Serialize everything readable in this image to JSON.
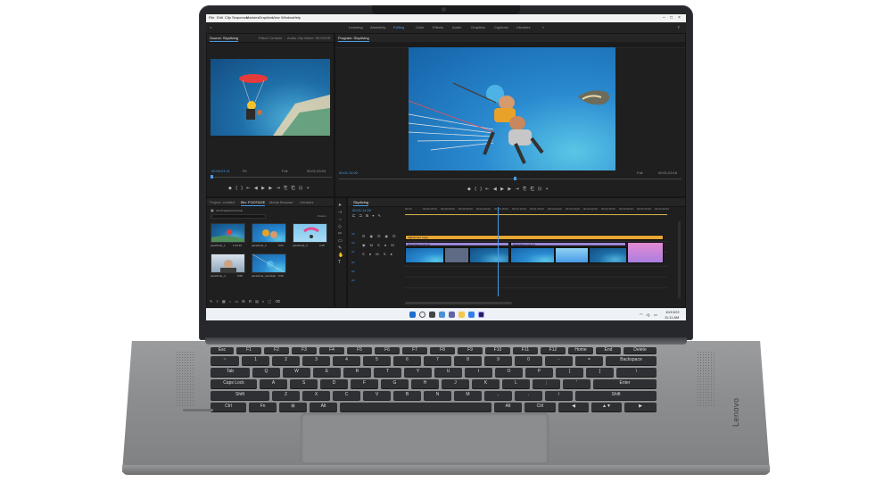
{
  "app": {
    "menu": [
      "File",
      "Edit",
      "Clip",
      "Sequence",
      "Markers",
      "Graphics",
      "View",
      "Window",
      "Help"
    ],
    "workspaces": [
      "Learning",
      "Assembly",
      "Editing",
      "Color",
      "Effects",
      "Audio",
      "Graphics",
      "Captions",
      "Libraries"
    ],
    "active_workspace": "Editing"
  },
  "source_panel": {
    "tabs": [
      "Source: Skydiving",
      "Effect Controls",
      "Audio Clip Mixer: SKYDIVE"
    ],
    "timecode_in": "00:00:01:11",
    "fit": "Fit",
    "fraction": "Full",
    "timecode_out": "00:01:23:04"
  },
  "program_panel": {
    "tabs": [
      "Program: Skydiving"
    ],
    "timecode_in": "00:01:11:00",
    "fit": "Fit",
    "fraction": "Full",
    "timecode_out": "00:01:23:16"
  },
  "project_panel": {
    "tabs": [
      "Project: Untitled",
      "Bin: FOOTAGE",
      "Media Browser",
      "Libraries"
    ],
    "path": "UNTITLED/FOOTAGE",
    "count": "6 items",
    "thumbnails": [
      {
        "label": "parachute_1",
        "duration": "1:23:16"
      },
      {
        "label": "parachute_2",
        "duration": "0:04"
      },
      {
        "label": "parachute_3",
        "duration": "0:15"
      },
      {
        "label": "parachute_4",
        "duration": "0:08"
      },
      {
        "label": "parachute_mountain",
        "duration": "0:09"
      },
      {
        "label": "parachute_sea",
        "duration": "0:12"
      }
    ]
  },
  "timeline": {
    "tab": "Skydiving",
    "timecode": "00:01:11:00",
    "ruler": [
      "00:00",
      "00:00:15:00",
      "00:00:30:00",
      "00:00:45:00",
      "00:01:00:00",
      "00:01:15:00",
      "00:01:30:00",
      "00:01:45:00",
      "00:02:00:00",
      "00:02:15:00",
      "00:02:30:00",
      "00:02:45:00",
      "00:03:00:00",
      "00:03:15:00",
      "00:03:30:00"
    ],
    "tracks": [
      "V3",
      "V2",
      "V1",
      "A1",
      "A2",
      "A3"
    ],
    "clips": [
      {
        "label": "Adjustment Layer",
        "color": "#e8a634"
      },
      {
        "label": "Parachute.mp4 [V]",
        "color": "#9a86d6"
      },
      {
        "label": "Parachute.mp4 [V]",
        "color": "#9a86d6"
      },
      {
        "label": "Parachute.mp4 [V]",
        "color": "#9a86d6"
      }
    ]
  },
  "taskbar": {
    "time": "11:11 AM",
    "date": "10/13/22"
  },
  "keyboard": {
    "row1": [
      "Esc",
      "F1",
      "F2",
      "F3",
      "F4",
      "F5",
      "F6",
      "F7",
      "F8",
      "F9",
      "F10",
      "F11",
      "F12",
      "Home",
      "End",
      "Delete"
    ],
    "row2": [
      "~",
      "1",
      "2",
      "3",
      "4",
      "5",
      "6",
      "7",
      "8",
      "9",
      "0",
      "-",
      "=",
      "Backspace"
    ],
    "row3": [
      "Tab",
      "Q",
      "W",
      "E",
      "R",
      "T",
      "Y",
      "U",
      "I",
      "O",
      "P",
      "[",
      "]",
      "\\"
    ],
    "row4": [
      "Caps Lock",
      "A",
      "S",
      "D",
      "F",
      "G",
      "H",
      "J",
      "K",
      "L",
      ";",
      "'",
      "Enter"
    ],
    "row5": [
      "Shift",
      "Z",
      "X",
      "C",
      "V",
      "B",
      "N",
      "M",
      ",",
      ".",
      "/",
      "Shift"
    ],
    "row6": [
      "Ctrl",
      "Fn",
      "⊞",
      "Alt",
      "",
      "Alt",
      "Ctrl",
      "◀",
      "▲▼",
      "▶"
    ]
  },
  "brand": "Lenovo",
  "colors": {
    "accent": "#4a9be8",
    "clip_orange": "#e8a634",
    "clip_purple": "#9a86d6",
    "clip_blue": "#4c8fd1"
  }
}
